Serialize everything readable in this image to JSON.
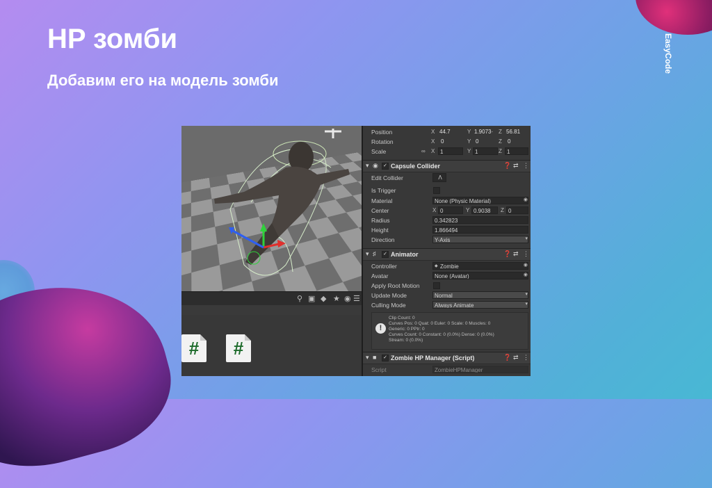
{
  "slide": {
    "title": "HP зомби",
    "subtitle": "Добавим его на модель зомби",
    "brand": "EasyCode"
  },
  "project": {
    "toolbar_icons": [
      "search-icon",
      "filter-icon",
      "tag-icon",
      "star-icon",
      "eye-icon",
      "layers-icon"
    ],
    "script_icon_glyph": "#"
  },
  "transform": {
    "position": {
      "label": "Position",
      "x": "44.7",
      "y": "1.9073·",
      "z": "56.81"
    },
    "rotation": {
      "label": "Rotation",
      "x": "0",
      "y": "0",
      "z": "0"
    },
    "scale": {
      "label": "Scale",
      "x": "1",
      "y": "1",
      "z": "1"
    }
  },
  "capsule": {
    "title": "Capsule Collider",
    "edit_collider": "Edit Collider",
    "is_trigger": "Is Trigger",
    "material_label": "Material",
    "material_value": "None (Physic Material)",
    "center_label": "Center",
    "center": {
      "x": "0",
      "y": "0.9038",
      "z": "0"
    },
    "radius_label": "Radius",
    "radius": "0.342823",
    "height_label": "Height",
    "height": "1.866494",
    "direction_label": "Direction",
    "direction": "Y-Axis"
  },
  "animator": {
    "title": "Animator",
    "controller_label": "Controller",
    "controller_value": "Zombie",
    "avatar_label": "Avatar",
    "avatar_value": "None (Avatar)",
    "root_motion_label": "Apply Root Motion",
    "update_mode_label": "Update Mode",
    "update_mode": "Normal",
    "culling_label": "Culling Mode",
    "culling": "Always Animate",
    "info": "Clip Count: 0\nCurves Pos: 0 Quat: 0 Euler: 0 Scale: 0 Muscles: 0\nGeneric: 0 PPtr: 0\nCurves Count: 0 Constant: 0 (0.0%) Dense: 0 (0.0%)\nStream: 0 (0.0%)"
  },
  "script": {
    "title": "Zombie HP Manager (Script)",
    "script_label": "Script",
    "script_value": "ZombieHPManager"
  },
  "axes": {
    "x": "X",
    "y": "Y",
    "z": "Z"
  }
}
